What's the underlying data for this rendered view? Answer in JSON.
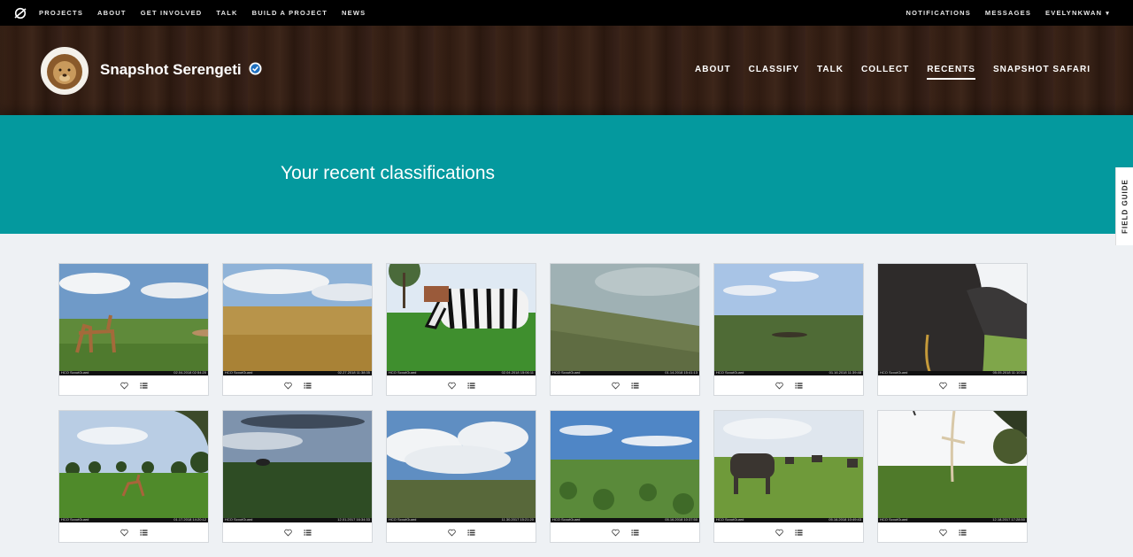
{
  "topnav": {
    "logo_icon": "zooniverse-logo-icon",
    "items": [
      "PROJECTS",
      "ABOUT",
      "GET INVOLVED",
      "TALK",
      "BUILD A PROJECT",
      "NEWS"
    ],
    "right": [
      "NOTIFICATIONS",
      "MESSAGES",
      "EVELYNKWAN"
    ]
  },
  "project": {
    "title": "Snapshot Serengeti",
    "avatar_icon": "lion-avatar",
    "verified_icon": "verified-check-icon",
    "nav": [
      "ABOUT",
      "CLASSIFY",
      "TALK",
      "COLLECT",
      "RECENTS",
      "SNAPSHOT SAFARI"
    ],
    "active_nav": "RECENTS"
  },
  "banner": {
    "title": "Your recent classifications"
  },
  "field_guide": {
    "label": "FIELD GUIDE"
  },
  "classifications": [
    {
      "camera": "HCO ScoutGuard",
      "timestamp": "02.04.2018 02:54:20",
      "scene": "gazelle"
    },
    {
      "camera": "HCO ScoutGuard",
      "timestamp": "02.27.2018 11:38:35",
      "scene": "dry-grass"
    },
    {
      "camera": "HCO ScoutGuard",
      "timestamp": "02.04.2018 15:06:11",
      "scene": "zebra"
    },
    {
      "camera": "HCO ScoutGuard",
      "timestamp": "01.14.2018 15:41:13",
      "scene": "tilted-plain"
    },
    {
      "camera": "HCO ScoutGuard",
      "timestamp": "01.16.2018 11:39:48",
      "scene": "plain"
    },
    {
      "camera": "HCO ScoutGuard",
      "timestamp": "05.05.2018 11:10:50",
      "scene": "wildebeest-close"
    },
    {
      "camera": "HCO ScoutGuard",
      "timestamp": "01.17.2018 14:20:12",
      "scene": "impala"
    },
    {
      "camera": "HCO ScoutGuard",
      "timestamp": "12.01.2017 16:34:33",
      "scene": "cloudy-plain"
    },
    {
      "camera": "HCO ScoutGuard",
      "timestamp": "11.30.2017 15:21:20",
      "scene": "clouds"
    },
    {
      "camera": "HCO ScoutGuard",
      "timestamp": "05.16.2018 10:37:50",
      "scene": "scrub"
    },
    {
      "camera": "HCO ScoutGuard",
      "timestamp": "05.16.2018 10:49:43",
      "scene": "wildebeest"
    },
    {
      "camera": "HCO ScoutGuard",
      "timestamp": "12.18.2017 17:28:50",
      "scene": "acacia"
    }
  ],
  "card_actions": {
    "favorite_icon": "heart-icon",
    "collect_icon": "list-icon"
  }
}
